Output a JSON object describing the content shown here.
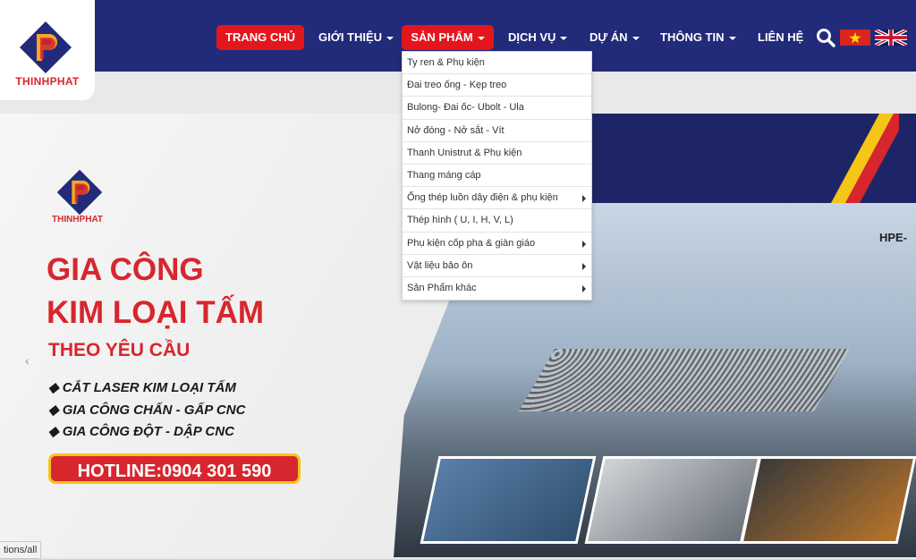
{
  "brand": {
    "name": "THINHPHAT",
    "accent": "#e4161d",
    "nav_bg": "#222a7a"
  },
  "nav": {
    "items": [
      {
        "label": "TRANG CHỦ",
        "active": true,
        "dropdown": false
      },
      {
        "label": "GIỚI THIỆU",
        "active": false,
        "dropdown": true
      },
      {
        "label": "SẢN PHẨM",
        "active": true,
        "dropdown": true
      },
      {
        "label": "DỊCH VỤ",
        "active": false,
        "dropdown": true
      },
      {
        "label": "DỰ ÁN",
        "active": false,
        "dropdown": true
      },
      {
        "label": "THÔNG TIN",
        "active": false,
        "dropdown": true
      },
      {
        "label": "LIÊN HỆ",
        "active": false,
        "dropdown": false
      }
    ],
    "search_icon": "search-icon",
    "languages": [
      "vietnamese-flag",
      "uk-flag"
    ]
  },
  "product_menu": {
    "items": [
      {
        "label": "Ty ren & Phụ kiện",
        "has_sub": false
      },
      {
        "label": "Đai treo ống - Kẹp treo",
        "has_sub": false
      },
      {
        "label": "Bulong- Đai ốc- Ubolt - Ula",
        "has_sub": false
      },
      {
        "label": "Nở đóng - Nở sắt - Vít",
        "has_sub": false
      },
      {
        "label": "Thanh Unistrut & Phụ kiện",
        "has_sub": false
      },
      {
        "label": "Thang máng cáp",
        "has_sub": false
      },
      {
        "label": "Ống thép luồn dây điện & phụ kiện",
        "has_sub": true
      },
      {
        "label": "Thép hình ( U, I, H, V, L)",
        "has_sub": false
      },
      {
        "label": "Phụ kiện cốp pha & giàn giáo",
        "has_sub": true
      },
      {
        "label": "Vật liệu bảo ôn",
        "has_sub": true
      },
      {
        "label": "Sản Phẩm khác",
        "has_sub": true
      }
    ]
  },
  "hero": {
    "logo_text": "THINHPHAT",
    "heading_1": "GIA CÔNG",
    "heading_2": "KIM LOẠI TẤM",
    "heading_3": "THEO YÊU CẦU",
    "bullets": [
      "CẮT LASER KIM LOẠI TẤM",
      "GIA CÔNG CHẤN - GẤP CNC",
      "GIA CÔNG ĐỘT - DẬP CNC"
    ],
    "hotline": "HOTLINE:0904 301 590",
    "machine_label": "HPE-",
    "prev_arrow": "‹"
  },
  "status_bar": {
    "text": "tions/all"
  }
}
